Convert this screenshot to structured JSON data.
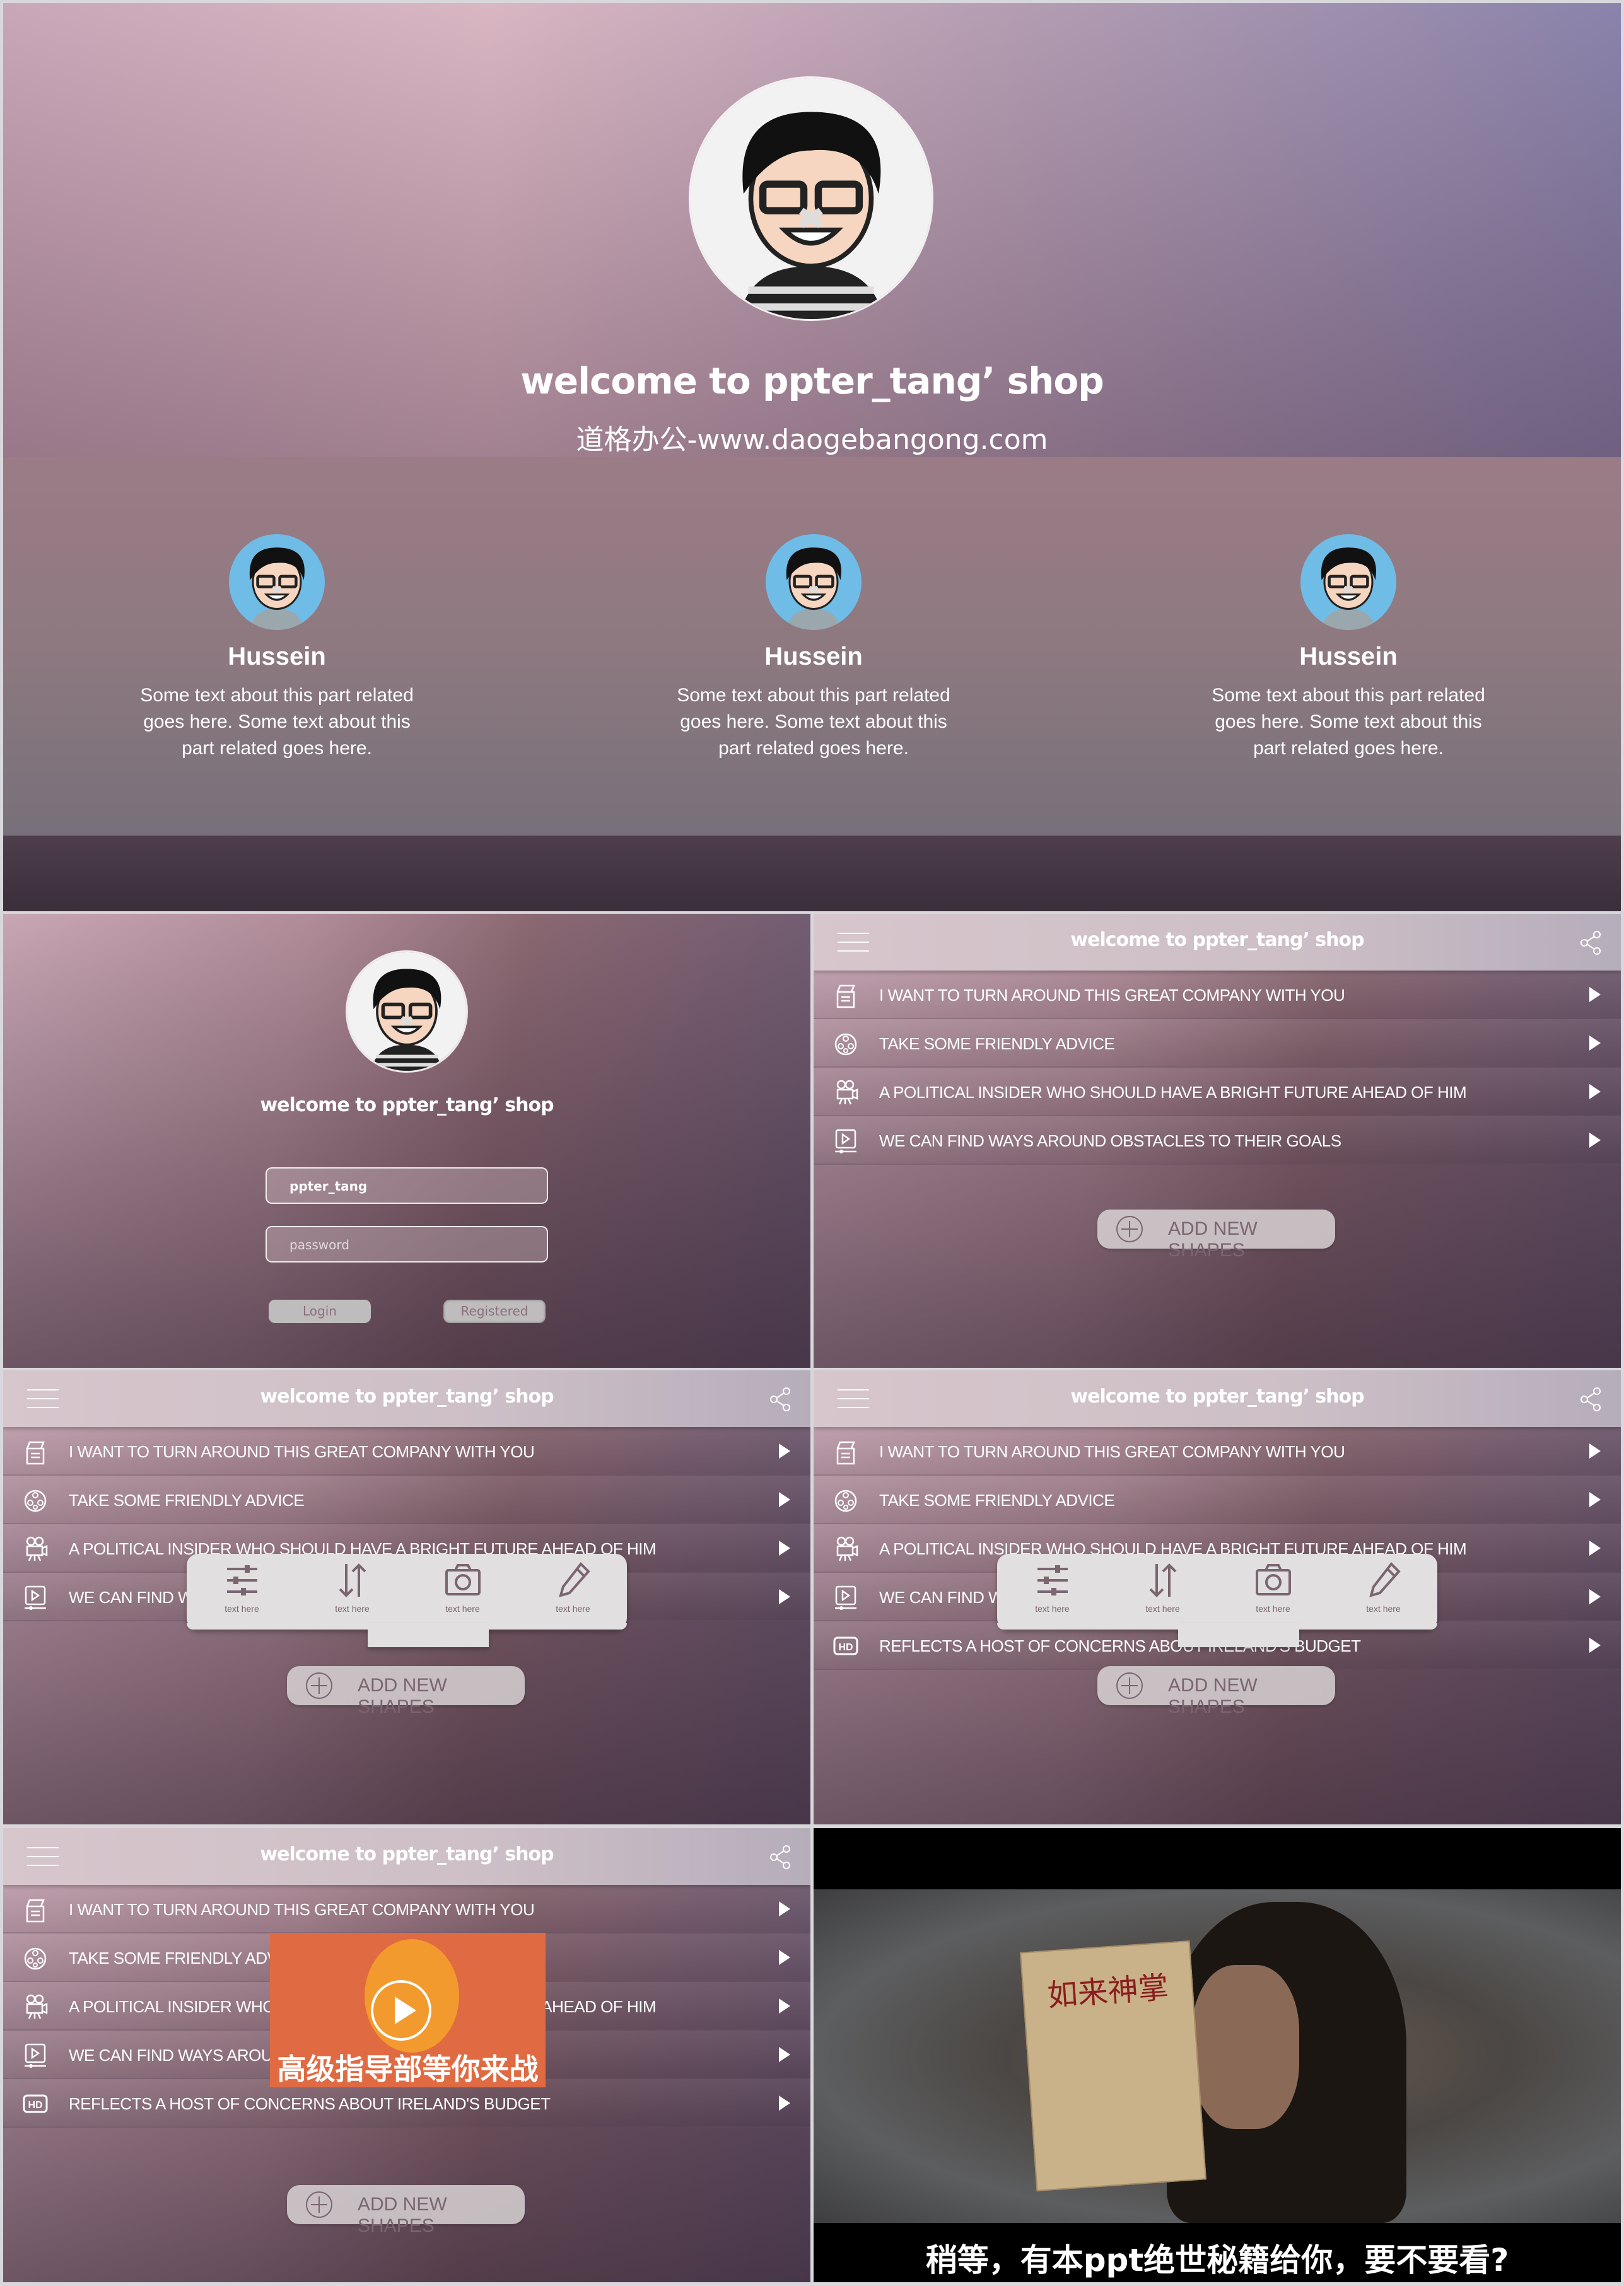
{
  "hero": {
    "title": "welcome to ppter_tang’ shop",
    "subtitle": "道格办公-www.daogebangong.com",
    "members": [
      {
        "name": "Hussein",
        "bio": "Some text about this part related goes here. Some text about this part related goes here."
      },
      {
        "name": "Hussein",
        "bio": "Some text about this part related goes here. Some text about this part related goes here."
      },
      {
        "name": "Hussein",
        "bio": "Some text about this part related goes here. Some text about this part related goes here."
      }
    ]
  },
  "login": {
    "title": "welcome to ppter_tang’ shop",
    "username_value": "ppter_tang",
    "password_placeholder": "password",
    "login_label": "Login",
    "register_label": "Registered"
  },
  "app": {
    "header_title": "welcome to ppter_tang’ shop",
    "menu_items": [
      {
        "icon": "clapperboard-icon",
        "label": "I WANT TO TURN AROUND THIS GREAT COMPANY WITH YOU"
      },
      {
        "icon": "film-reel-icon",
        "label": "TAKE SOME FRIENDLY ADVICE"
      },
      {
        "icon": "movie-camera-icon",
        "label": "A POLITICAL INSIDER WHO SHOULD HAVE A BRIGHT FUTURE AHEAD OF HIM"
      },
      {
        "icon": "video-player-icon",
        "label": "WE CAN FIND WAYS AROUND OBSTACLES TO THEIR GOALS"
      },
      {
        "icon": "hd-icon",
        "label": "REFLECTS A HOST OF CONCERNS ABOUT IRELAND'S BUDGET"
      }
    ],
    "add_button_label": "ADD NEW SHAPES",
    "toolbar": [
      {
        "icon": "sliders-icon",
        "label": "text here"
      },
      {
        "icon": "sort-arrows-icon",
        "label": "text here"
      },
      {
        "icon": "camera-icon",
        "label": "text here"
      },
      {
        "icon": "pencil-icon",
        "label": "text here"
      }
    ],
    "video_thumbnail_caption": "高级指导部等你来战"
  },
  "video": {
    "book_title": "如来神掌",
    "subtitle": "稍等，有本ppt绝世秘籍给你，要不要看?"
  },
  "colors": {
    "accent_orange": "#e06a42",
    "button_text": "#7a6570",
    "popup_bg": "#e1dfe0"
  }
}
